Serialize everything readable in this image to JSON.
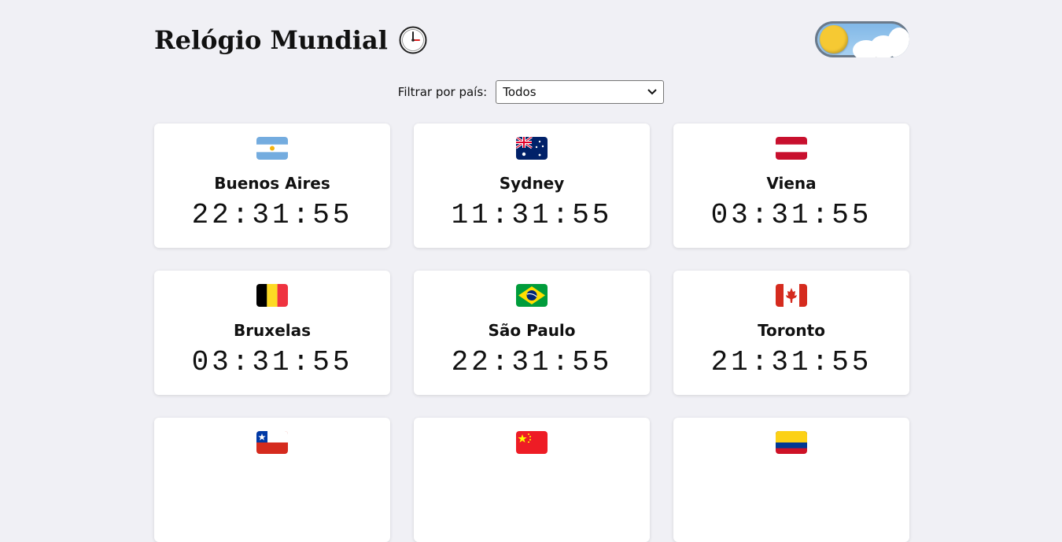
{
  "header": {
    "title": "Relógio Mundial",
    "clock_icon": "clock-icon",
    "theme_toggle": "day-mode-toggle"
  },
  "filter": {
    "label": "Filtrar por país:",
    "selected": "Todos"
  },
  "cities": [
    {
      "name": "Buenos Aires",
      "time": "22:31:55",
      "flag": "argentina-flag"
    },
    {
      "name": "Sydney",
      "time": "11:31:55",
      "flag": "australia-flag"
    },
    {
      "name": "Viena",
      "time": "03:31:55",
      "flag": "austria-flag"
    },
    {
      "name": "Bruxelas",
      "time": "03:31:55",
      "flag": "belgium-flag"
    },
    {
      "name": "São Paulo",
      "time": "22:31:55",
      "flag": "brazil-flag"
    },
    {
      "name": "Toronto",
      "time": "21:31:55",
      "flag": "canada-flag"
    },
    {
      "name": "",
      "time": "",
      "flag": "chile-flag"
    },
    {
      "name": "",
      "time": "",
      "flag": "china-flag"
    },
    {
      "name": "",
      "time": "",
      "flag": "colombia-flag"
    }
  ]
}
